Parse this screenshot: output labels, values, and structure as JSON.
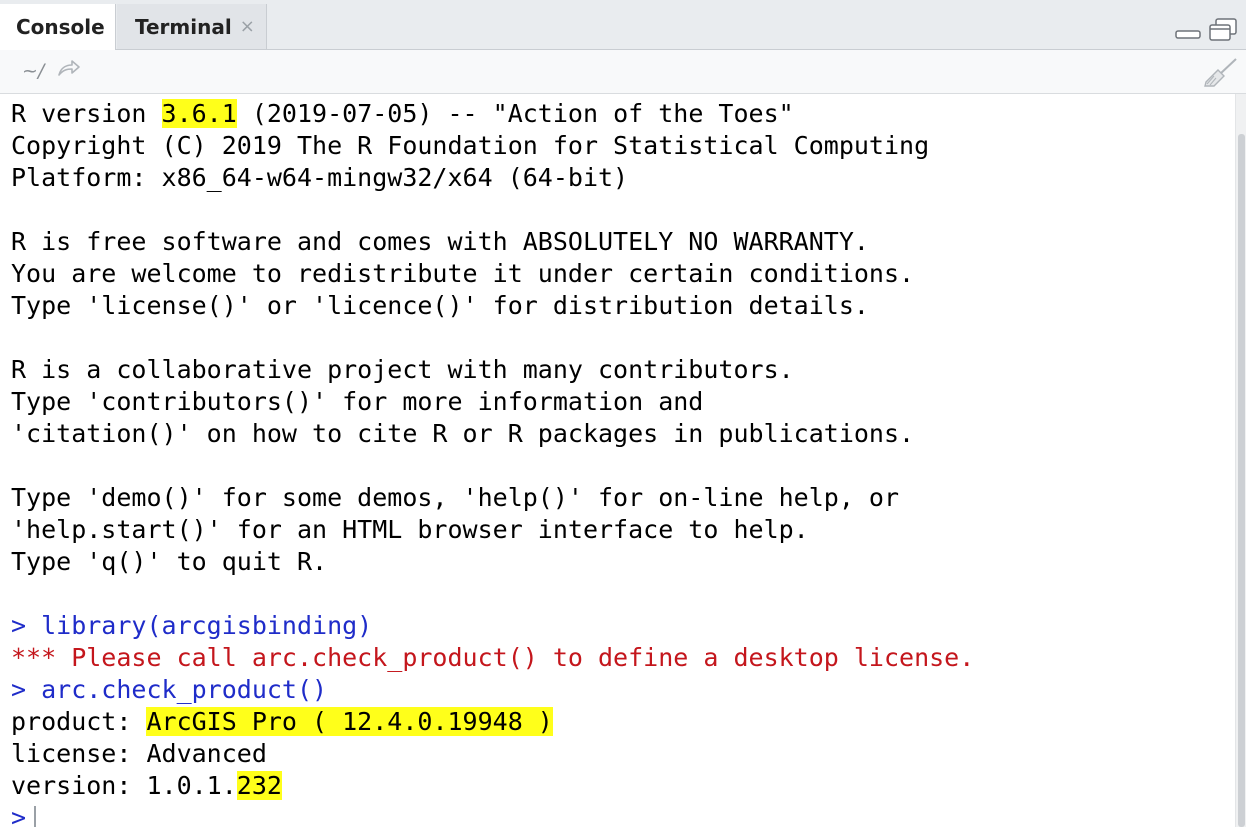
{
  "tabs": [
    {
      "label": "Console",
      "active": true
    },
    {
      "label": "Terminal",
      "close": "×"
    }
  ],
  "toolbar": {
    "path": "~/"
  },
  "icons": {
    "minimize": "minimize-icon",
    "maximize": "maximize-icon",
    "navigate": "go-to-directory-icon",
    "clear": "broom-icon"
  },
  "colors": {
    "command": "#1f2cc9",
    "error": "#c4161c",
    "highlight": "#ffff1a"
  },
  "console": {
    "l1": {
      "a": "R version ",
      "hl": "3.6.1",
      "b": " (2019-07-05) -- \"Action of the Toes\""
    },
    "l2": "Copyright (C) 2019 The R Foundation for Statistical Computing",
    "l3": "Platform: x86_64-w64-mingw32/x64 (64-bit)",
    "l4": "R is free software and comes with ABSOLUTELY NO WARRANTY.",
    "l5": "You are welcome to redistribute it under certain conditions.",
    "l6": "Type 'license()' or 'licence()' for distribution details.",
    "l7": "R is a collaborative project with many contributors.",
    "l8": "Type 'contributors()' for more information and",
    "l9": "'citation()' on how to cite R or R packages in publications.",
    "l10": "Type 'demo()' for some demos, 'help()' for on-line help, or",
    "l11": "'help.start()' for an HTML browser interface to help.",
    "l12": "Type 'q()' to quit R.",
    "cmd1": "> library(arcgisbinding)",
    "err1": "*** Please call arc.check_product() to define a desktop license.",
    "cmd2": "> arc.check_product()",
    "product": {
      "a": "product: ",
      "hl": "ArcGIS Pro ( 12.4.0.19948 )"
    },
    "license": "license: Advanced",
    "version": {
      "a": "version: 1.0.1.",
      "hl": "232"
    },
    "prompt": ">"
  }
}
